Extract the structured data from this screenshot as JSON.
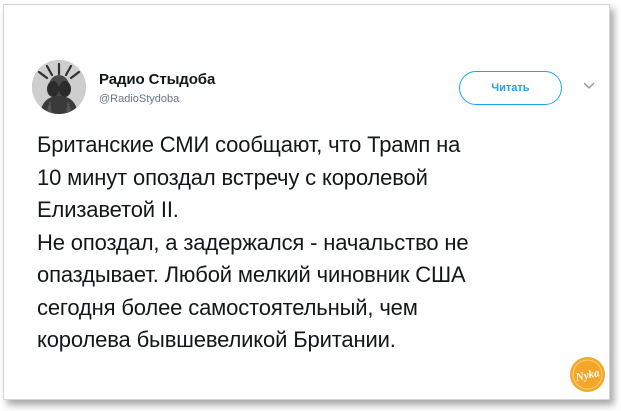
{
  "account": {
    "name": "Радио Стыдоба",
    "handle": "@RadioStydoba"
  },
  "follow_label": "Читать",
  "tweet_lines": [
    "Британские СМИ сообщают, что Трамп на",
    "10 минут опоздал встречу с королевой",
    "Елизаветой II.",
    "Не опоздал, а задержался - начальство не",
    "опаздывает. Любой мелкий чиновник США",
    "сегодня более самостоятельный, чем",
    "королева бывшевеликой Британии."
  ],
  "watermark_text": "Nyka",
  "icons": {
    "menu": "chevron-down-icon",
    "avatar": "statue-of-liberty-facepalm",
    "watermark": "nyka-logo"
  },
  "colors": {
    "accent": "#1da1f2",
    "text": "#14171a",
    "secondary": "#657786",
    "logo": "#f4a62a"
  }
}
